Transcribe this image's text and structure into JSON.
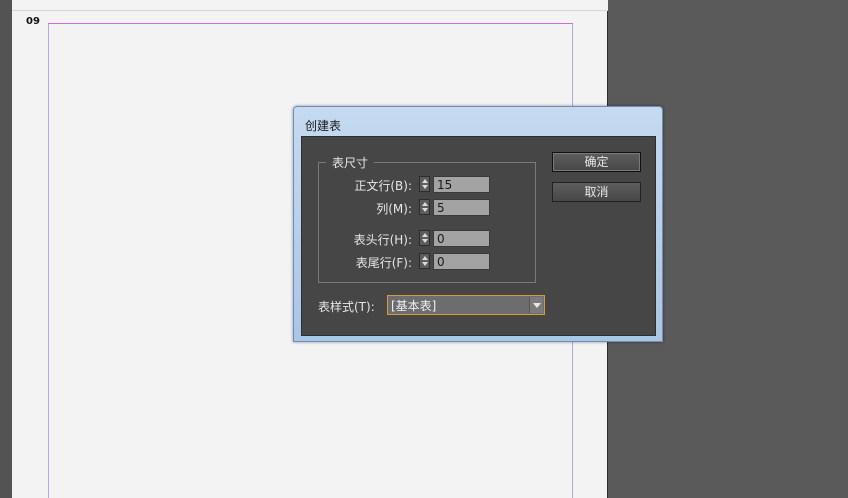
{
  "document": {
    "page_number": "09"
  },
  "dialog": {
    "title": "创建表",
    "group_title": "表尺寸",
    "fields": [
      {
        "label": "正文行(B):",
        "value": "15"
      },
      {
        "label": "列(M):",
        "value": "5"
      },
      {
        "label": "表头行(H):",
        "value": "0"
      },
      {
        "label": "表尾行(F):",
        "value": "0"
      }
    ],
    "ok_label": "确定",
    "cancel_label": "取消",
    "style_label": "表样式(T):",
    "style_value": "[基本表]"
  },
  "colors": {
    "canvas_bg": "#5a5a5a",
    "document_bg": "#f3f3f3",
    "margin_guide": "#d36bd8",
    "column_guide": "#b7a6e0",
    "dialog_title_bar": "#b8d0ea",
    "dialog_body": "#464646",
    "focus_border": "#d39b3a"
  },
  "icons": {
    "spinner": "up-down-arrows-icon",
    "dropdown": "chevron-down-icon"
  }
}
